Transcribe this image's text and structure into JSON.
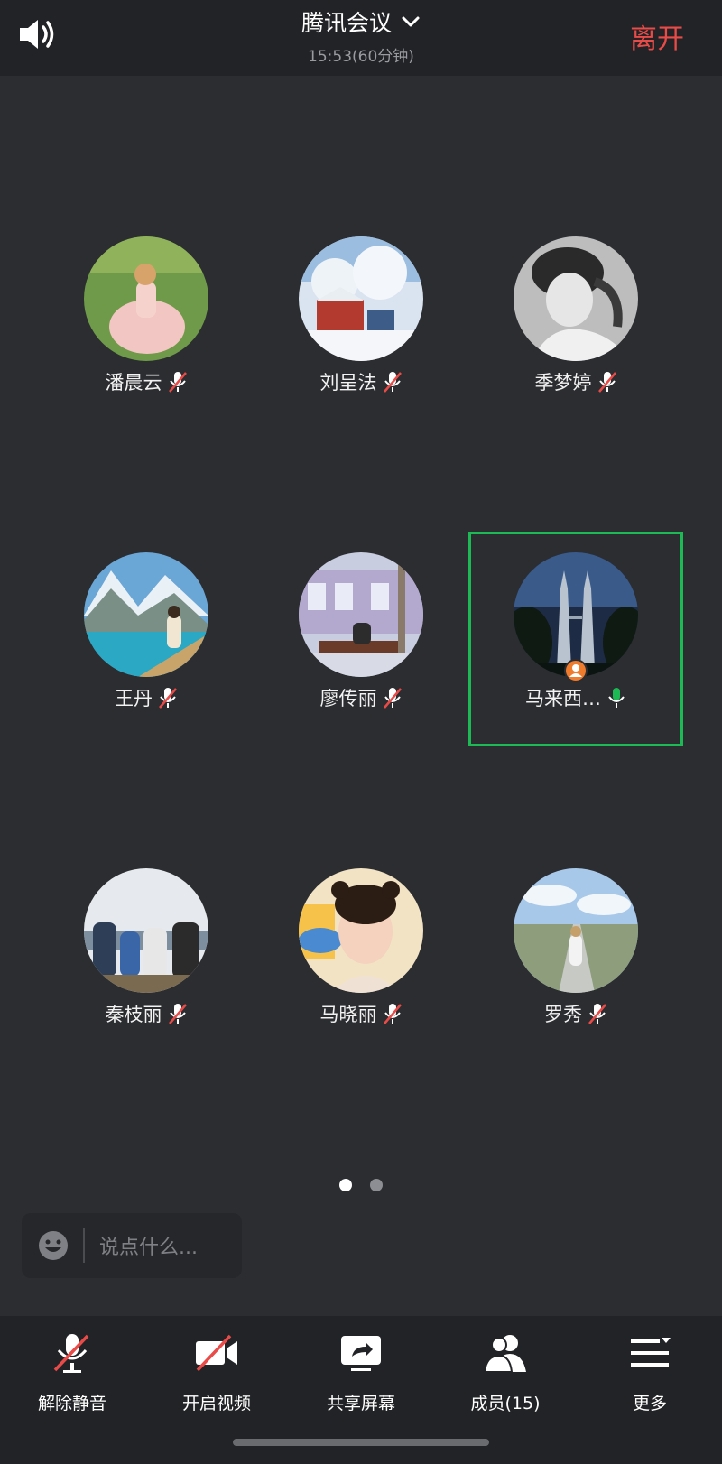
{
  "header": {
    "title": "腾讯会议",
    "subtitle": "15:53(60分钟)",
    "leave_label": "离开",
    "icons": {
      "speaker": "speaker-icon",
      "dropdown": "chevron-down-icon"
    }
  },
  "participants": [
    {
      "name": "潘晨云",
      "mic": "muted"
    },
    {
      "name": "刘呈法",
      "mic": "muted"
    },
    {
      "name": "季梦婷",
      "mic": "muted"
    },
    {
      "name": "王丹",
      "mic": "muted"
    },
    {
      "name": "廖传丽",
      "mic": "muted"
    },
    {
      "name": "马来西…",
      "mic": "active",
      "host": true,
      "speaking": true
    },
    {
      "name": "秦枝丽",
      "mic": "muted"
    },
    {
      "name": "马晓丽",
      "mic": "muted"
    },
    {
      "name": "罗秀",
      "mic": "muted"
    }
  ],
  "pagination": {
    "pages": 2,
    "current": 1
  },
  "chat": {
    "placeholder": "说点什么..."
  },
  "toolbar": [
    {
      "label": "解除静音",
      "icon": "mic-muted-icon"
    },
    {
      "label": "开启视频",
      "icon": "camera-off-icon"
    },
    {
      "label": "共享屏幕",
      "icon": "share-screen-icon"
    },
    {
      "label": "成员(15)",
      "icon": "members-icon"
    },
    {
      "label": "更多",
      "icon": "more-menu-icon"
    }
  ],
  "colors": {
    "background": "#2c2d31",
    "bar": "#222326",
    "leave": "#e84b48",
    "active_speaker": "#1db954",
    "host_badge": "#ef7b2d"
  }
}
